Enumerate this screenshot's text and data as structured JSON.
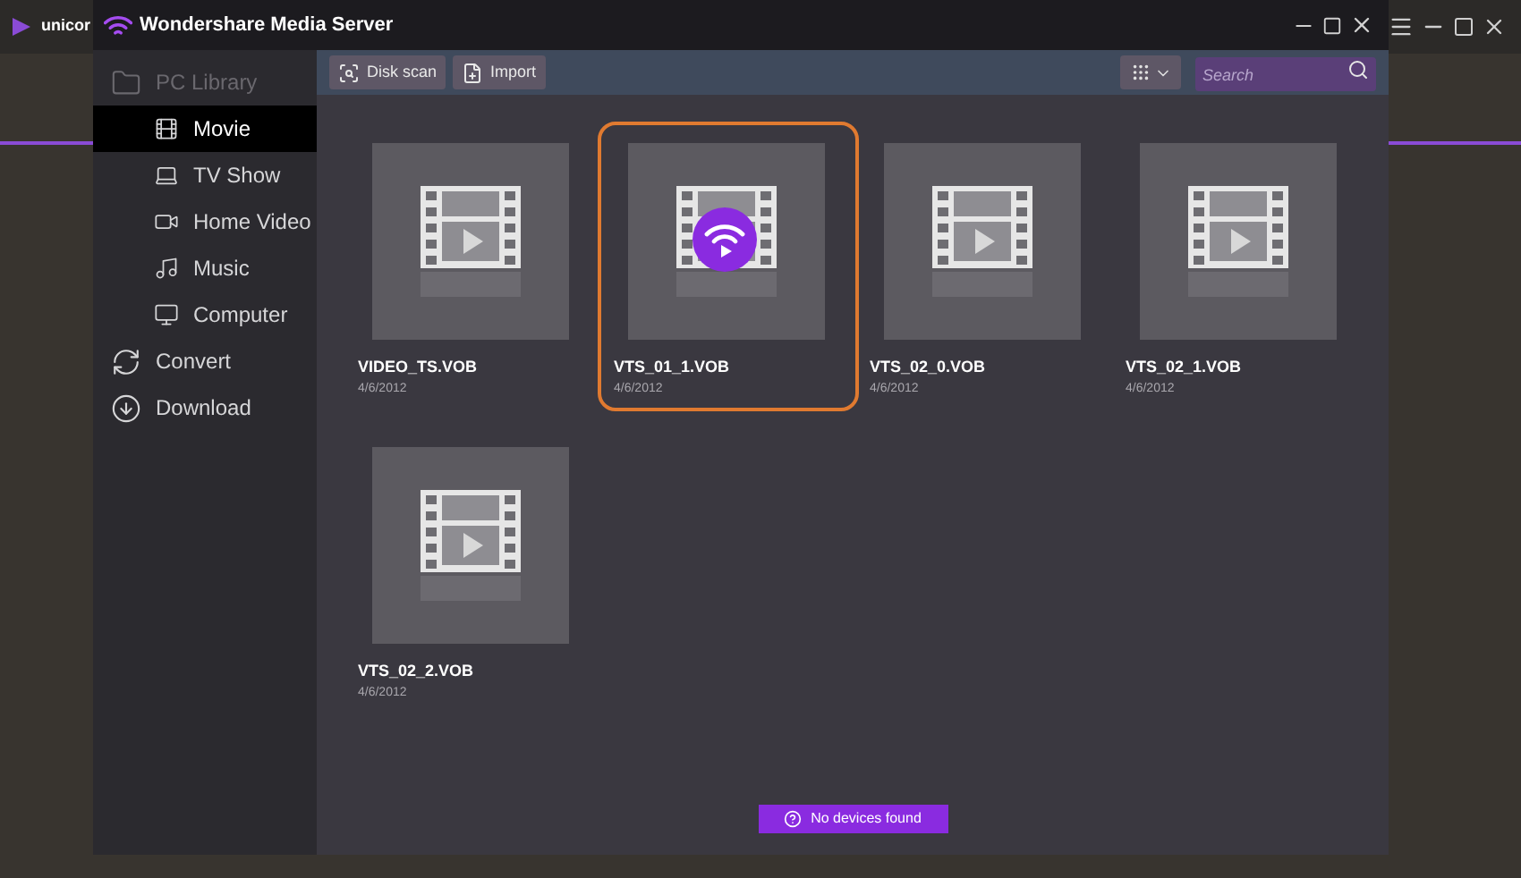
{
  "background_app": {
    "title": "unicor"
  },
  "window": {
    "title": "Wondershare Media Server"
  },
  "sidebar": {
    "items": [
      {
        "label": "PC Library",
        "kind": "library",
        "selected": false,
        "children": [
          {
            "label": "Movie",
            "kind": "movie",
            "selected": true
          },
          {
            "label": "TV Show",
            "kind": "tv",
            "selected": false
          },
          {
            "label": "Home Video",
            "kind": "camera",
            "selected": false
          },
          {
            "label": "Music",
            "kind": "music",
            "selected": false
          },
          {
            "label": "Computer",
            "kind": "computer",
            "selected": false
          }
        ]
      },
      {
        "label": "Convert",
        "kind": "convert",
        "selected": false
      },
      {
        "label": "Download",
        "kind": "download",
        "selected": false
      }
    ]
  },
  "toolbar": {
    "buttons": [
      {
        "label": "Disk scan",
        "kind": "scan"
      },
      {
        "label": "Import",
        "kind": "import"
      }
    ],
    "search": {
      "placeholder": "Search"
    }
  },
  "files": [
    {
      "name": "VIDEO_TS.VOB",
      "date": "4/6/2012",
      "selected": false,
      "streaming": false
    },
    {
      "name": "VTS_01_1.VOB",
      "date": "4/6/2012",
      "selected": true,
      "streaming": true
    },
    {
      "name": "VTS_02_0.VOB",
      "date": "4/6/2012",
      "selected": false,
      "streaming": false
    },
    {
      "name": "VTS_02_1.VOB",
      "date": "4/6/2012",
      "selected": false,
      "streaming": false
    },
    {
      "name": "VTS_02_2.VOB",
      "date": "4/6/2012",
      "selected": false,
      "streaming": false
    }
  ],
  "status": {
    "message": "No devices found"
  }
}
